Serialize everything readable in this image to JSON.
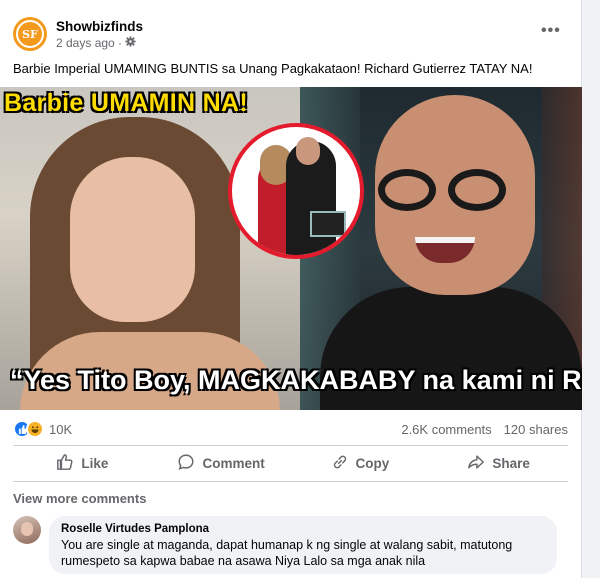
{
  "post": {
    "page_name": "Showbizfinds",
    "avatar_text": "SF",
    "time": "2 days ago ·",
    "more_label": "•••",
    "caption": "Barbie Imperial UMAMING BUNTIS sa Unang Pagkakataon! Richard Gutierrez TATAY NA!"
  },
  "photo": {
    "headline": "Barbie UMAMIN NA!",
    "quote": "“Yes Tito Boy, MAGKAKABABY na kami ni Richard”"
  },
  "stats": {
    "reaction_count": "10K",
    "comments": "2.6K comments",
    "shares": "120 shares"
  },
  "actions": {
    "like": "Like",
    "comment": "Comment",
    "copy": "Copy",
    "share": "Share"
  },
  "comments": {
    "view_more": "View more comments",
    "items": [
      {
        "author": "Roselle Virtudes Pamplona",
        "line1": "You are single at maganda, dapat humanap k ng single at walang sabit, matutong",
        "line2": "rumespeto sa kapwa babae na asawa Niya Lalo sa mga anak nila"
      }
    ]
  },
  "colors": {
    "accent": "#1877f2",
    "muted": "#65676b",
    "brand_orange": "#f39a1d",
    "inset_border": "#e41b2c",
    "headline_yellow": "#ffdc00"
  },
  "icons": [
    "settings-gear-icon",
    "like-reaction-icon",
    "haha-reaction-icon",
    "thumbs-up-icon",
    "comment-bubble-icon",
    "copy-link-icon",
    "share-arrow-icon"
  ]
}
